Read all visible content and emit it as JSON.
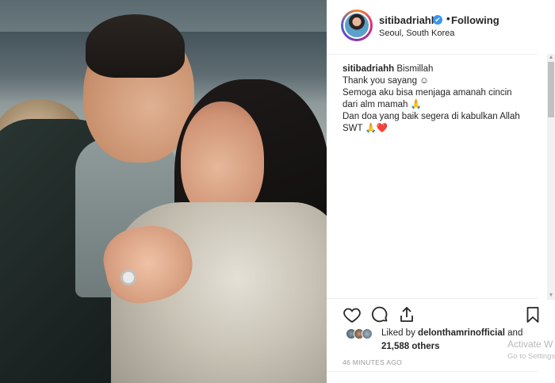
{
  "post": {
    "username": "sitibadriahh",
    "verified_mark": "✔",
    "separator": "•",
    "follow_status": "Following",
    "location": "Seoul, South Korea"
  },
  "caption": {
    "username": "sitibadriahh",
    "lines": [
      "Bismillah",
      "Thank you sayang ☺",
      "Semoga aku bisa menjaga amanah cincin",
      "dari alm mamah 🙏",
      "Dan doa yang baik segera di kabulkan Allah",
      "SWT 🙏❤️"
    ]
  },
  "actions": {
    "like_icon": "heart-icon",
    "comment_icon": "comment-icon",
    "share_icon": "share-icon",
    "save_icon": "bookmark-icon"
  },
  "likes": {
    "prefix": "Liked by",
    "user": "delonthamrinofficial",
    "conjunction": "and",
    "count_text": "21,588 others"
  },
  "timestamp": "46 MINUTES AGO",
  "watermark": {
    "line1": "Activate W",
    "line2": "Go to Settings"
  },
  "scrollbar": {
    "up": "▲",
    "down": "▼"
  }
}
